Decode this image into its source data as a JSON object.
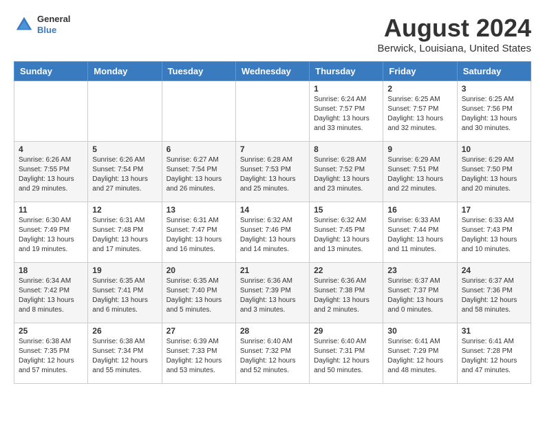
{
  "header": {
    "logo_general": "General",
    "logo_blue": "Blue",
    "main_title": "August 2024",
    "sub_title": "Berwick, Louisiana, United States"
  },
  "days_of_week": [
    "Sunday",
    "Monday",
    "Tuesday",
    "Wednesday",
    "Thursday",
    "Friday",
    "Saturday"
  ],
  "weeks": [
    [
      {
        "day": "",
        "info": ""
      },
      {
        "day": "",
        "info": ""
      },
      {
        "day": "",
        "info": ""
      },
      {
        "day": "",
        "info": ""
      },
      {
        "day": "1",
        "info": "Sunrise: 6:24 AM\nSunset: 7:57 PM\nDaylight: 13 hours\nand 33 minutes."
      },
      {
        "day": "2",
        "info": "Sunrise: 6:25 AM\nSunset: 7:57 PM\nDaylight: 13 hours\nand 32 minutes."
      },
      {
        "day": "3",
        "info": "Sunrise: 6:25 AM\nSunset: 7:56 PM\nDaylight: 13 hours\nand 30 minutes."
      }
    ],
    [
      {
        "day": "4",
        "info": "Sunrise: 6:26 AM\nSunset: 7:55 PM\nDaylight: 13 hours\nand 29 minutes."
      },
      {
        "day": "5",
        "info": "Sunrise: 6:26 AM\nSunset: 7:54 PM\nDaylight: 13 hours\nand 27 minutes."
      },
      {
        "day": "6",
        "info": "Sunrise: 6:27 AM\nSunset: 7:54 PM\nDaylight: 13 hours\nand 26 minutes."
      },
      {
        "day": "7",
        "info": "Sunrise: 6:28 AM\nSunset: 7:53 PM\nDaylight: 13 hours\nand 25 minutes."
      },
      {
        "day": "8",
        "info": "Sunrise: 6:28 AM\nSunset: 7:52 PM\nDaylight: 13 hours\nand 23 minutes."
      },
      {
        "day": "9",
        "info": "Sunrise: 6:29 AM\nSunset: 7:51 PM\nDaylight: 13 hours\nand 22 minutes."
      },
      {
        "day": "10",
        "info": "Sunrise: 6:29 AM\nSunset: 7:50 PM\nDaylight: 13 hours\nand 20 minutes."
      }
    ],
    [
      {
        "day": "11",
        "info": "Sunrise: 6:30 AM\nSunset: 7:49 PM\nDaylight: 13 hours\nand 19 minutes."
      },
      {
        "day": "12",
        "info": "Sunrise: 6:31 AM\nSunset: 7:48 PM\nDaylight: 13 hours\nand 17 minutes."
      },
      {
        "day": "13",
        "info": "Sunrise: 6:31 AM\nSunset: 7:47 PM\nDaylight: 13 hours\nand 16 minutes."
      },
      {
        "day": "14",
        "info": "Sunrise: 6:32 AM\nSunset: 7:46 PM\nDaylight: 13 hours\nand 14 minutes."
      },
      {
        "day": "15",
        "info": "Sunrise: 6:32 AM\nSunset: 7:45 PM\nDaylight: 13 hours\nand 13 minutes."
      },
      {
        "day": "16",
        "info": "Sunrise: 6:33 AM\nSunset: 7:44 PM\nDaylight: 13 hours\nand 11 minutes."
      },
      {
        "day": "17",
        "info": "Sunrise: 6:33 AM\nSunset: 7:43 PM\nDaylight: 13 hours\nand 10 minutes."
      }
    ],
    [
      {
        "day": "18",
        "info": "Sunrise: 6:34 AM\nSunset: 7:42 PM\nDaylight: 13 hours\nand 8 minutes."
      },
      {
        "day": "19",
        "info": "Sunrise: 6:35 AM\nSunset: 7:41 PM\nDaylight: 13 hours\nand 6 minutes."
      },
      {
        "day": "20",
        "info": "Sunrise: 6:35 AM\nSunset: 7:40 PM\nDaylight: 13 hours\nand 5 minutes."
      },
      {
        "day": "21",
        "info": "Sunrise: 6:36 AM\nSunset: 7:39 PM\nDaylight: 13 hours\nand 3 minutes."
      },
      {
        "day": "22",
        "info": "Sunrise: 6:36 AM\nSunset: 7:38 PM\nDaylight: 13 hours\nand 2 minutes."
      },
      {
        "day": "23",
        "info": "Sunrise: 6:37 AM\nSunset: 7:37 PM\nDaylight: 13 hours\nand 0 minutes."
      },
      {
        "day": "24",
        "info": "Sunrise: 6:37 AM\nSunset: 7:36 PM\nDaylight: 12 hours\nand 58 minutes."
      }
    ],
    [
      {
        "day": "25",
        "info": "Sunrise: 6:38 AM\nSunset: 7:35 PM\nDaylight: 12 hours\nand 57 minutes."
      },
      {
        "day": "26",
        "info": "Sunrise: 6:38 AM\nSunset: 7:34 PM\nDaylight: 12 hours\nand 55 minutes."
      },
      {
        "day": "27",
        "info": "Sunrise: 6:39 AM\nSunset: 7:33 PM\nDaylight: 12 hours\nand 53 minutes."
      },
      {
        "day": "28",
        "info": "Sunrise: 6:40 AM\nSunset: 7:32 PM\nDaylight: 12 hours\nand 52 minutes."
      },
      {
        "day": "29",
        "info": "Sunrise: 6:40 AM\nSunset: 7:31 PM\nDaylight: 12 hours\nand 50 minutes."
      },
      {
        "day": "30",
        "info": "Sunrise: 6:41 AM\nSunset: 7:29 PM\nDaylight: 12 hours\nand 48 minutes."
      },
      {
        "day": "31",
        "info": "Sunrise: 6:41 AM\nSunset: 7:28 PM\nDaylight: 12 hours\nand 47 minutes."
      }
    ]
  ]
}
